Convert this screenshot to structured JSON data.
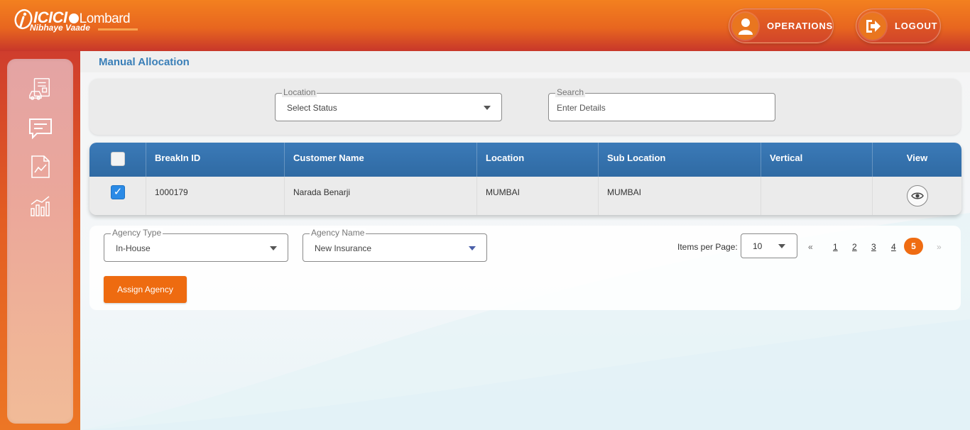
{
  "header": {
    "logo_brand": "ICICI",
    "logo_brand_suffix": "Lombard",
    "logo_tagline": "Nibhaye Vaade",
    "operations_label": "OPERATIONS",
    "logout_label": "LOGOUT"
  },
  "sidebar": {
    "items": [
      {
        "icon": "claim-document-icon"
      },
      {
        "icon": "message-icon"
      },
      {
        "icon": "report-icon"
      },
      {
        "icon": "analytics-chart-icon"
      }
    ]
  },
  "page": {
    "title": "Manual Allocation"
  },
  "filters": {
    "location_label": "Location",
    "location_value": "Select Status",
    "search_label": "Search",
    "search_placeholder": "Enter Details"
  },
  "table": {
    "columns": [
      "BreakIn ID",
      "Customer Name",
      "Location",
      "Sub Location",
      "Vertical",
      "View"
    ],
    "rows": [
      {
        "checked": true,
        "breakin_id": "1000179",
        "customer_name": "Narada Benarji",
        "location": "MUMBAI",
        "sub_location": "MUMBAI",
        "vertical": ""
      }
    ]
  },
  "allocation": {
    "agency_type_label": "Agency Type",
    "agency_type_value": "In-House",
    "agency_name_label": "Agency Name",
    "agency_name_value": "New Insurance",
    "assign_label": "Assign Agency"
  },
  "pagination": {
    "items_per_page_label": "Items per Page:",
    "items_per_page_value": "10",
    "prev": "«",
    "next": "»",
    "pages": [
      "1",
      "2",
      "3",
      "4",
      "5"
    ],
    "current": "5"
  },
  "colors": {
    "brand_orange": "#ee6b10",
    "header_blue": "#3b7ab8",
    "checkbox_blue": "#2a8ae6"
  }
}
